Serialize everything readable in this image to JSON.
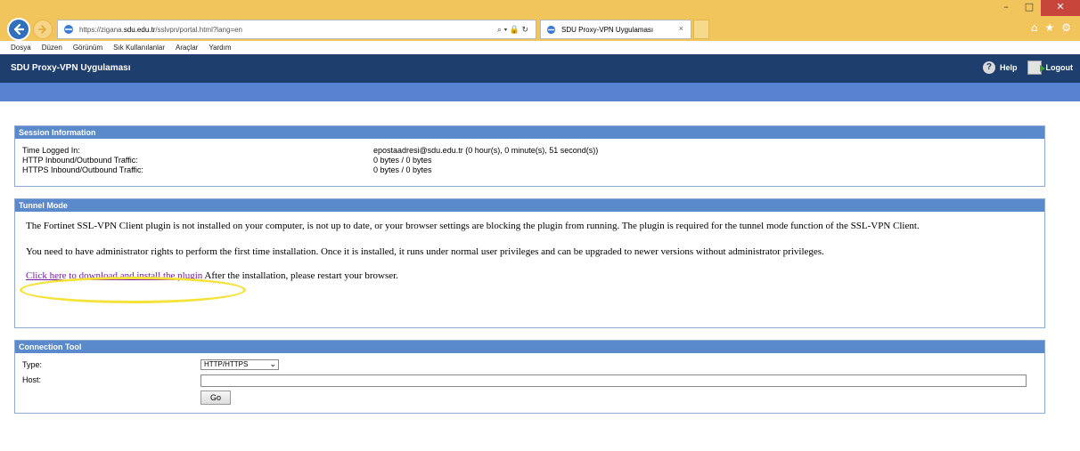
{
  "browser": {
    "url_prefix": "https://zigana.",
    "url_domain": "sdu.edu.tr",
    "url_path": "/sslvpn/portal.html?lang=en",
    "addr_tools": "⌕ ▾ 🔒 ↻",
    "tab_title": "SDU Proxy-VPN Uygulaması",
    "tab_close": "×",
    "window_controls": [
      "–",
      "□",
      "✕"
    ],
    "right_icons": [
      "⌂",
      "★",
      "⚙"
    ],
    "menu": [
      "Dosya",
      "Düzen",
      "Görünüm",
      "Sık Kullanılanlar",
      "Araçlar",
      "Yardım"
    ]
  },
  "app": {
    "title": "SDU Proxy-VPN Uygulaması",
    "help_label": "Help",
    "help_icon_glyph": "?",
    "logout_label": "Logout"
  },
  "session": {
    "heading": "Session Information",
    "rows": [
      {
        "label": "Time Logged In:",
        "value": "epostaadresi@sdu.edu.tr (0 hour(s), 0 minute(s), 51 second(s))"
      },
      {
        "label": "HTTP Inbound/Outbound Traffic:",
        "value": "0 bytes / 0 bytes"
      },
      {
        "label": "HTTPS Inbound/Outbound Traffic:",
        "value": "0 bytes / 0 bytes"
      }
    ]
  },
  "tunnel": {
    "heading": "Tunnel Mode",
    "para1": "The Fortinet SSL-VPN Client plugin is not installed on your computer, is not up to date, or your browser settings are blocking the plugin from running. The plugin is required for the tunnel mode function of the SSL-VPN Client.",
    "para2": "You need to have administrator rights to perform the first time installation. Once it is installed, it runs under normal user privileges and can be upgraded to newer versions without administrator privileges.",
    "link_text": "Click here to download and install the plugin",
    "after_link": " After the installation, please restart your browser.",
    "highlight_color": "#f5e23a"
  },
  "connection": {
    "heading": "Connection Tool",
    "type_label": "Type:",
    "type_value": "HTTP/HTTPS",
    "host_label": "Host:",
    "host_value": "",
    "go_label": "Go"
  }
}
